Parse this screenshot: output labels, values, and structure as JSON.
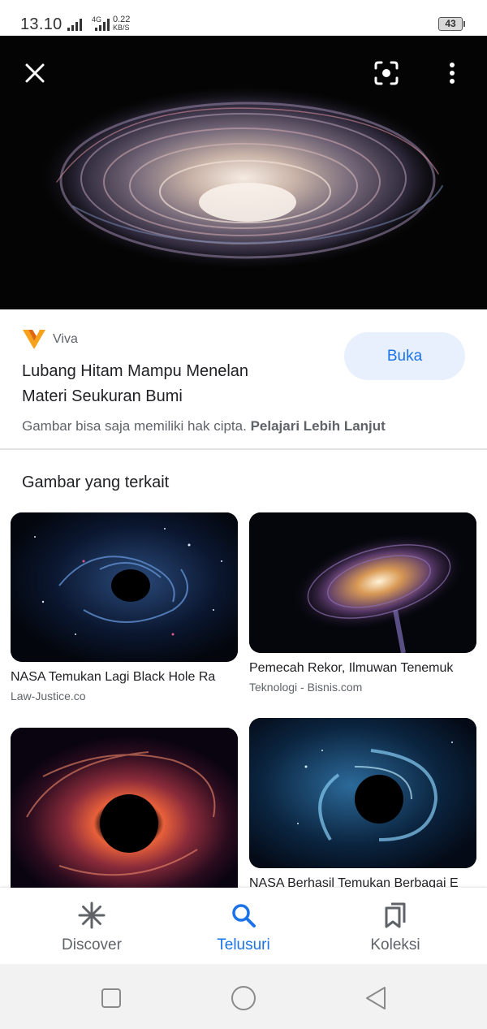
{
  "status_bar": {
    "time": "13.10",
    "network_label": "4G",
    "speed_value": "0.22",
    "speed_unit": "KB/S",
    "battery": "43"
  },
  "hero": {
    "icons": [
      "close-icon",
      "lens-icon",
      "more-vert-icon"
    ]
  },
  "result": {
    "source_name": "Viva",
    "title_line1": "Lubang Hitam Mampu Menelan",
    "title_line2": "Materi Seukuran Bumi",
    "open_label": "Buka",
    "copyright_text": "Gambar bisa saja memiliki hak cipta.",
    "copyright_link": "Pelajari Lebih Lanjut"
  },
  "related": {
    "heading": "Gambar yang terkait",
    "items": [
      {
        "title": "NASA Temukan Lagi Black Hole Ra",
        "source": "Law-Justice.co"
      },
      {
        "title": "Pemecah Rekor, Ilmuwan Tenemuk",
        "source": "Teknologi - Bisnis.com"
      },
      {
        "title": "",
        "source": ""
      },
      {
        "title": "NASA Berhasil Temukan Berbagai E",
        "source": ""
      }
    ]
  },
  "bottom_nav": {
    "items": [
      {
        "label": "Discover",
        "icon": "asterisk-icon",
        "active": false
      },
      {
        "label": "Telusuri",
        "icon": "search-icon",
        "active": true
      },
      {
        "label": "Koleksi",
        "icon": "collections-icon",
        "active": false
      }
    ]
  },
  "colors": {
    "accent": "#1a73e8",
    "button_bg": "#e8f0fe",
    "viva_orange": "#f7a21b"
  }
}
